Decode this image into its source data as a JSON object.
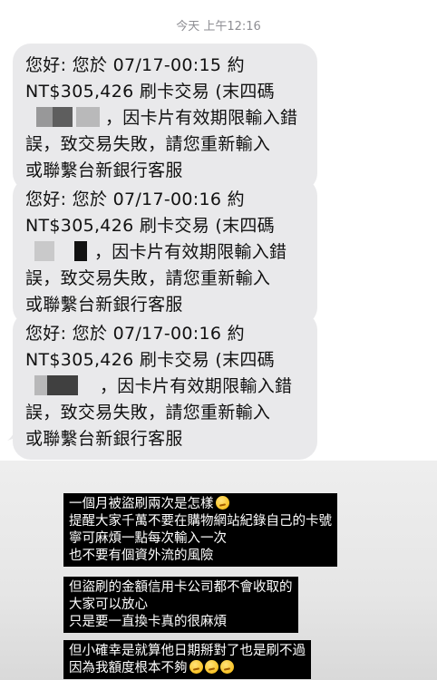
{
  "timestamp": "今天 上午12:16",
  "messages": [
    {
      "line1": "您好: 您於 07/17-00:15 約",
      "line2": "NT$305,426 刷卡交易 (末四碼",
      "line3": "，因卡片有效期限輸入錯",
      "line4": "誤，致交易失敗，請您重新輸入",
      "line5": "或聯繫台新銀行客服"
    },
    {
      "line1": "您好: 您於 07/17-00:16 約",
      "line2": "NT$305,426 刷卡交易 (末四碼",
      "line3": "，因卡片有效期限輸入錯",
      "line4": "誤，致交易失敗，請您重新輸入",
      "line5": "或聯繫台新銀行客服"
    },
    {
      "line1": "您好: 您於 07/17-00:16 約",
      "line2": "NT$305,426 刷卡交易 (末四碼",
      "line3": "，因卡片有效期限輸入錯",
      "line4": "誤，致交易失敗，請您重新輸入",
      "line5": "或聯繫台新銀行客服"
    }
  ],
  "captions": [
    {
      "lines": [
        "一個月被盜刷兩次是怎樣",
        "提醒大家千萬不要在購物網站紀錄自己的卡號",
        "寧可麻煩一點每次輸入一次",
        "也不要有個資外流的風險"
      ]
    },
    {
      "lines": [
        "但盜刷的金額信用卡公司都不會收取的",
        "大家可以放心",
        "只是要一直換卡真的很麻煩"
      ]
    },
    {
      "lines": [
        "但小確幸是就算他日期掰對了也是刷不過",
        "因為我額度根本不夠"
      ]
    }
  ],
  "icons": {
    "censor": "blurred-block",
    "emoji": "woozy-face-emoji"
  },
  "colors": {
    "bubble": "#e9e9eb",
    "caption_bg": "#000000",
    "timestamp": "#8e8e93"
  }
}
